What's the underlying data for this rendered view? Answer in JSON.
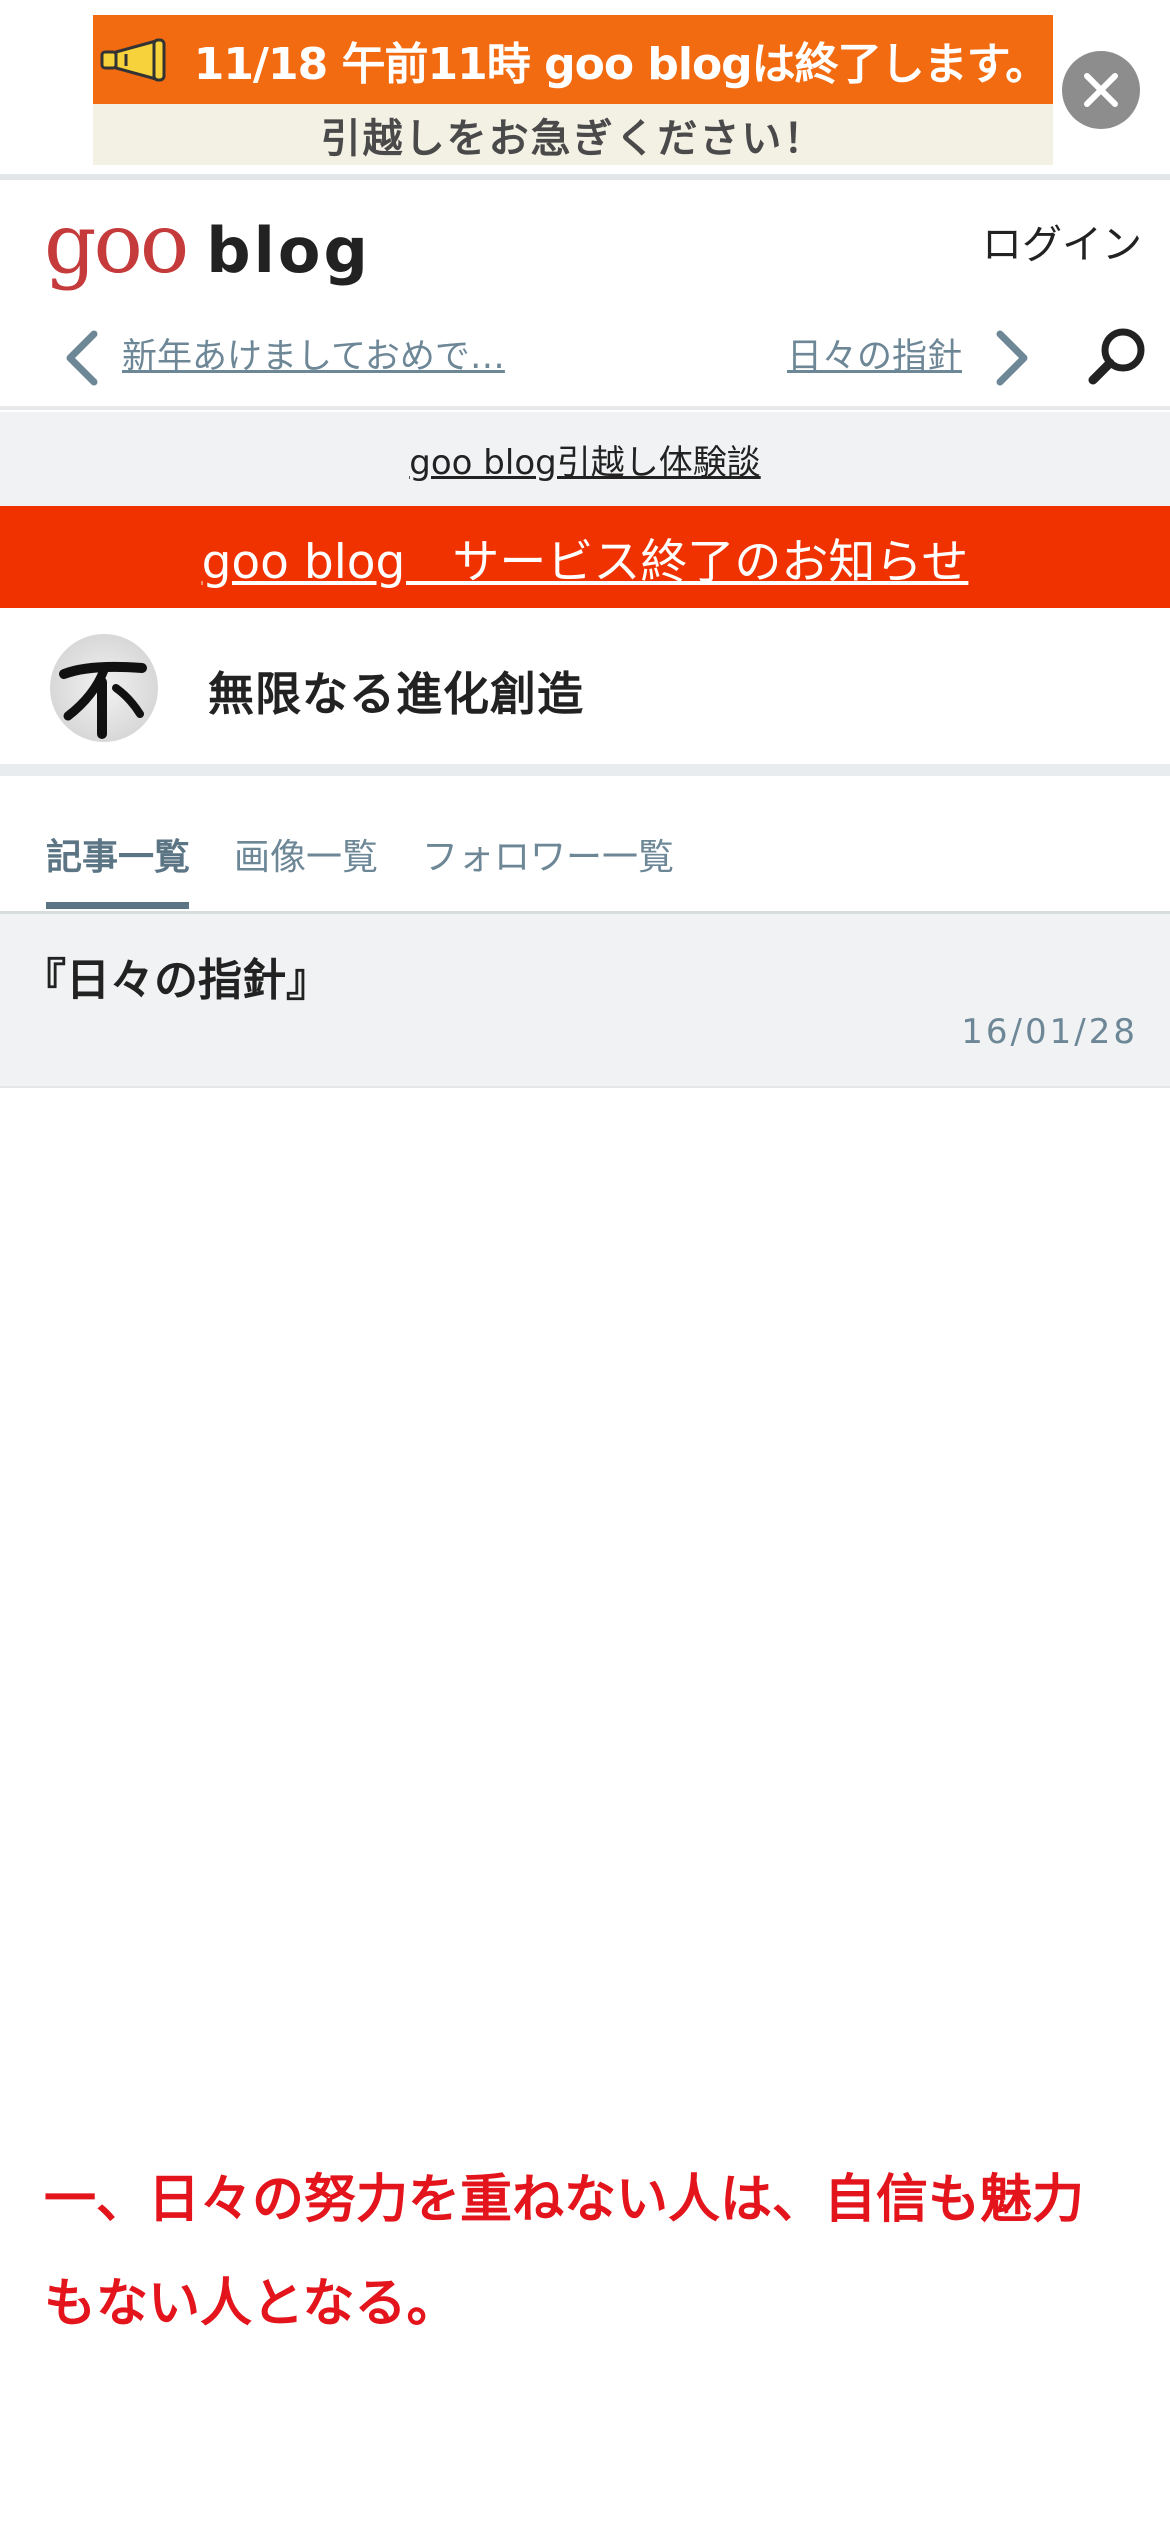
{
  "banner": {
    "line1": "11/18 午前11時 goo blogは終了します。",
    "line2": "引越しをお急ぎください！",
    "icon": "megaphone-icon",
    "close_icon": "close-icon"
  },
  "header": {
    "logo_goo": "goo",
    "logo_blog": "blog",
    "login_label": "ログイン",
    "prev_article": "新年あけましておめで…",
    "next_article": "日々の指針",
    "search_icon": "search-icon"
  },
  "info_strip": {
    "link": "goo blog引越し体験談"
  },
  "notice": {
    "link": "goo blog　サービス終了のお知らせ"
  },
  "blog": {
    "title": "無限なる進化創造"
  },
  "tabs": [
    {
      "label": "記事一覧",
      "active": true
    },
    {
      "label": "画像一覧",
      "active": false
    },
    {
      "label": "フォロワー一覧",
      "active": false
    }
  ],
  "article": {
    "title": "『日々の指針』",
    "date": "16/01/28",
    "body": "一、日々の努力を重ねない人は、自信も魅力もない人となる。"
  },
  "colors": {
    "banner_orange": "#f26b10",
    "notice_red": "#ef3200",
    "logo_red": "#c53a3a",
    "accent_slate": "#6d8797",
    "body_red": "#e3141b"
  }
}
